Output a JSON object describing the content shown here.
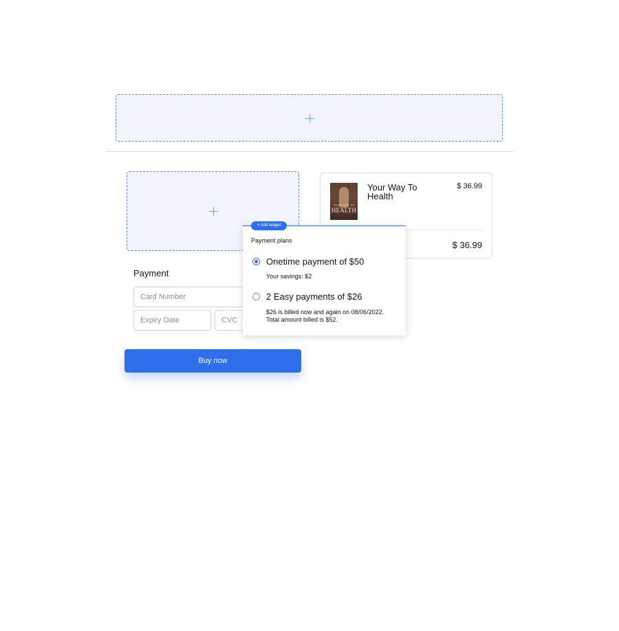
{
  "icons": {
    "drop_zone_top": "plus-icon",
    "drop_zone_left": "plus-icon",
    "add_widget": "plus-icon"
  },
  "colors": {
    "accent": "#2f6fec",
    "drop_zone_fill": "#f2f5fd",
    "drop_zone_border": "#5b84e8"
  },
  "order_summary": {
    "product": {
      "image_alt": "book-cover",
      "cover_small_text": "YOUR WAY TO",
      "cover_big_text": "HEALTH",
      "name": "Your Way To Health",
      "price": "$ 36.99"
    },
    "total": "$ 36.99"
  },
  "payment": {
    "heading": "Payment",
    "card_number_placeholder": "Card Number",
    "expiry_placeholder": "Expiry Date",
    "cvc_placeholder": "CVC",
    "buy_button_label": "Buy now"
  },
  "plans_panel": {
    "add_widget_label": "+ Add widget",
    "title": "Payment plans",
    "options": [
      {
        "label": "Onetime payment of $50",
        "note_lines": [
          "Your savings: $2"
        ],
        "selected": true
      },
      {
        "label": "2 Easy payments of $26",
        "note_lines": [
          "$26 is billed now and again on 08/06/2022.",
          "Total amount billed is $52."
        ],
        "selected": false
      }
    ]
  }
}
